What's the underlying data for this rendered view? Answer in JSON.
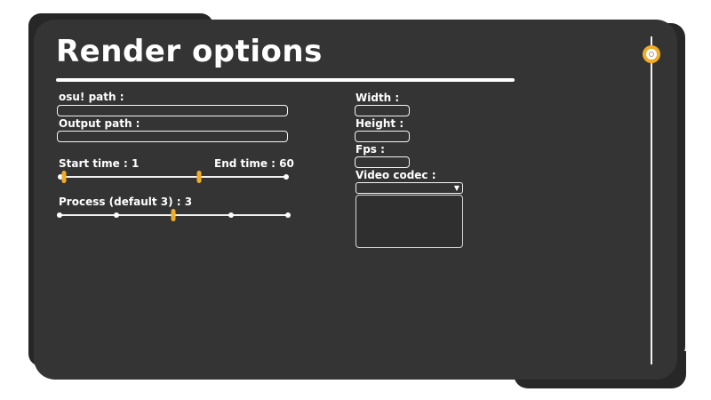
{
  "window": {
    "title": "Render options"
  },
  "left": {
    "osu_path": {
      "label": "osu! path :",
      "value": ""
    },
    "output_path": {
      "label": "Output path :",
      "value": ""
    },
    "time_range": {
      "start_label": "Start time : 1",
      "end_label": "End time : 60",
      "start_value": 1,
      "end_value": 60
    },
    "process": {
      "label": "Process (default 3) : 3",
      "value": 3,
      "ticks": 5
    }
  },
  "right": {
    "width": {
      "label": "Width :",
      "value": ""
    },
    "height": {
      "label": "Height :",
      "value": ""
    },
    "fps": {
      "label": "Fps :",
      "value": ""
    },
    "video_codec": {
      "label": "Video codec :",
      "selected": "",
      "dropdown_icon": "triangle-down-icon"
    }
  },
  "colors": {
    "panel": "#343434",
    "frame": "#272727",
    "accent": "#f0ad27"
  }
}
